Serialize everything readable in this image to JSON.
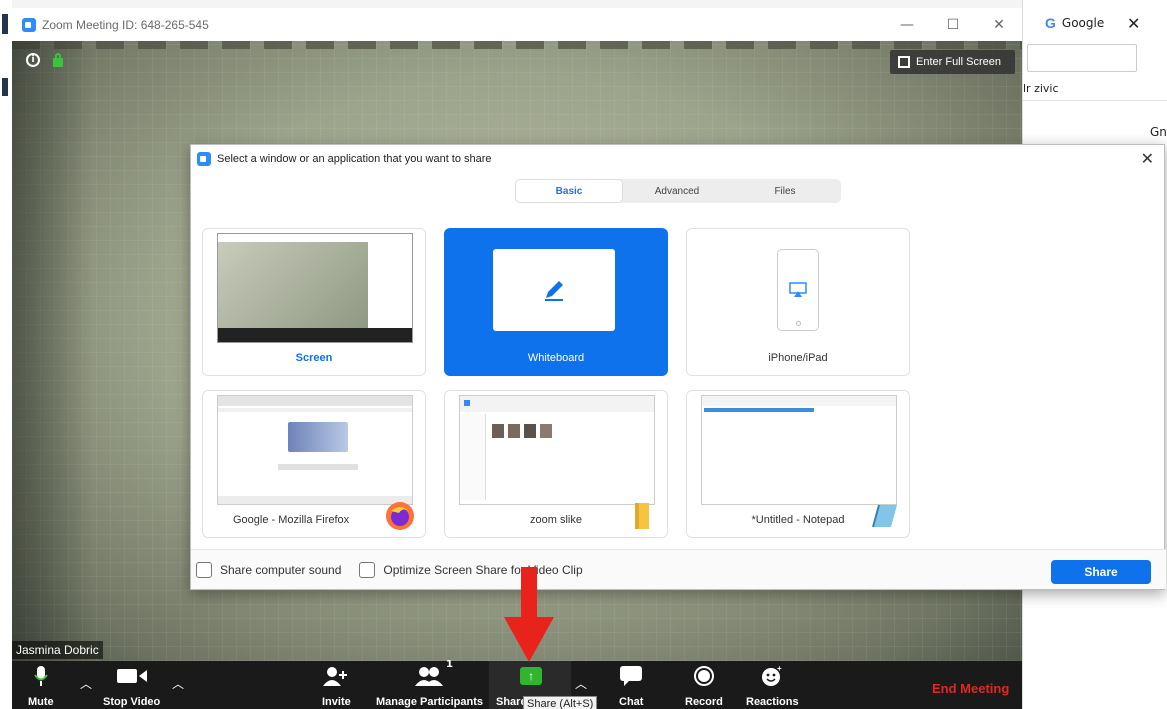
{
  "window": {
    "title": "Zoom Meeting ID: 648-265-545",
    "fullscreen_label": "Enter Full Screen"
  },
  "participant_name": "Jasmina Dobric",
  "background_browser": {
    "tab_title": "Google",
    "user_fragment": "lr zivic",
    "side_text": "Gn"
  },
  "share_dialog": {
    "title": "Select a window or an application that you want to share",
    "tabs": [
      {
        "label": "Basic",
        "active": true
      },
      {
        "label": "Advanced",
        "active": false
      },
      {
        "label": "Files",
        "active": false
      }
    ],
    "tiles": [
      {
        "label": "Screen",
        "selected": false
      },
      {
        "label": "Whiteboard",
        "selected": true
      },
      {
        "label": "iPhone/iPad",
        "selected": false
      },
      {
        "label": "Google - Mozilla Firefox",
        "selected": false
      },
      {
        "label": "zoom slike",
        "selected": false
      },
      {
        "label": "*Untitled - Notepad",
        "selected": false
      }
    ],
    "options": {
      "share_sound": "Share computer sound",
      "optimize_video": "Optimize Screen Share for Video Clip"
    },
    "share_button": "Share"
  },
  "toolbar": {
    "mute": "Mute",
    "stop_video": "Stop Video",
    "invite": "Invite",
    "manage_participants": "Manage Participants",
    "participants_count": "1",
    "share_screen": "Share Screen",
    "share_tooltip": "Share (Alt+S)",
    "chat": "Chat",
    "record": "Record",
    "reactions": "Reactions",
    "end_meeting": "End Meeting"
  },
  "colors": {
    "accent": "#0e72ed",
    "end_meeting": "#e02828",
    "share_green": "#2fb52f",
    "arrow_red": "#e8231c"
  },
  "icons": [
    "info-icon",
    "lock-icon",
    "fullscreen-icon",
    "microphone-icon",
    "video-camera-icon",
    "add-user-icon",
    "participants-icon",
    "share-screen-icon",
    "chat-icon",
    "record-icon",
    "reactions-icon",
    "pencil-icon",
    "airplay-icon",
    "firefox-icon",
    "folder-icon",
    "notepad-icon",
    "close-icon"
  ]
}
